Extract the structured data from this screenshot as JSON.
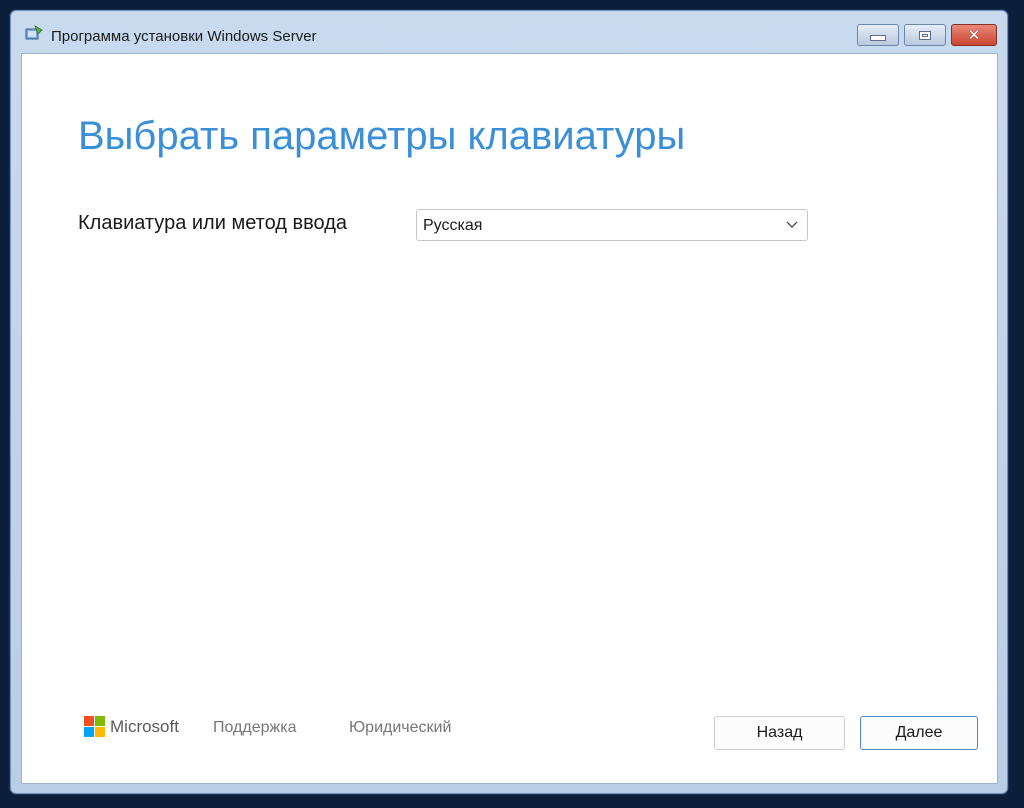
{
  "window": {
    "title": "Программа установки Windows Server",
    "controls": {
      "minimize": "minimize",
      "maximize": "maximize",
      "close": "✕"
    }
  },
  "page": {
    "heading": "Выбрать параметры клавиатуры",
    "keyboard_label": "Клавиатура или метод ввода",
    "keyboard_selected": "Русская"
  },
  "footer": {
    "brand": "Microsoft",
    "support_link": "Поддержка",
    "legal_link": "Юридический",
    "back_button": "Назад",
    "next_button": "Далее"
  },
  "icons": {
    "title_icon": "setup-icon",
    "dropdown": "chevron-down-icon",
    "brand_logo": "microsoft-logo-icon"
  },
  "colors": {
    "accent": "#3a8fd6",
    "ms_red": "#f25022",
    "ms_green": "#7fba00",
    "ms_blue": "#00a4ef",
    "ms_yellow": "#ffb900"
  }
}
